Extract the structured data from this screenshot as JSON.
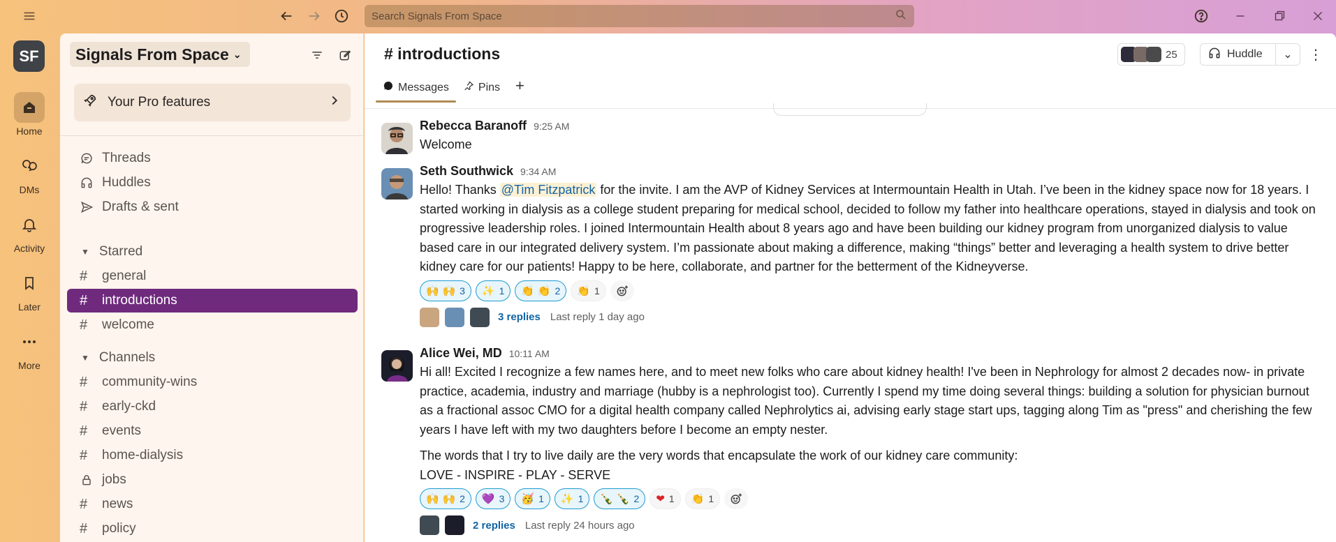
{
  "topbar": {
    "search_placeholder": "Search Signals From Space"
  },
  "rail": {
    "workspace_initials": "SF",
    "items": [
      {
        "label": "Home",
        "icon": "home-icon"
      },
      {
        "label": "DMs",
        "icon": "dms-icon"
      },
      {
        "label": "Activity",
        "icon": "bell-icon"
      },
      {
        "label": "Later",
        "icon": "bookmark-icon"
      },
      {
        "label": "More",
        "icon": "more-icon"
      }
    ]
  },
  "sidebar": {
    "workspace_name": "Signals From Space",
    "pro_features": "Your Pro features",
    "nav": [
      {
        "label": "Threads",
        "icon": "threads-icon"
      },
      {
        "label": "Huddles",
        "icon": "headphones-icon"
      },
      {
        "label": "Drafts & sent",
        "icon": "send-icon"
      }
    ],
    "starred_label": "Starred",
    "starred": [
      "general",
      "introductions",
      "welcome"
    ],
    "channels_label": "Channels",
    "channels": [
      {
        "name": "community-wins",
        "icon": "#"
      },
      {
        "name": "early-ckd",
        "icon": "#"
      },
      {
        "name": "events",
        "icon": "#"
      },
      {
        "name": "home-dialysis",
        "icon": "#"
      },
      {
        "name": "jobs",
        "icon": "lock"
      },
      {
        "name": "news",
        "icon": "#"
      },
      {
        "name": "policy",
        "icon": "#"
      }
    ]
  },
  "channel": {
    "title": "# introductions",
    "member_count": "25",
    "huddle_label": "Huddle",
    "tabs": [
      {
        "label": "Messages"
      },
      {
        "label": "Pins"
      }
    ]
  },
  "messages": [
    {
      "author": "Rebecca Baranoff",
      "time": "9:25 AM",
      "paragraphs": [
        "Welcome"
      ]
    },
    {
      "author": "Seth Southwick",
      "time": "9:34 AM",
      "text_before": "Hello! Thanks ",
      "mention": "@Tim Fitzpatrick",
      "text_after": " for the invite.  I am the AVP of Kidney Services at Intermountain Health in Utah.  I’ve been in the kidney space now for 18 years.  I started working in dialysis as a college student preparing for medical school, decided to follow my father into healthcare operations, stayed in dialysis and took on progressive leadership roles.  I joined Intermountain Health about 8 years ago and have been building our kidney program from unorganized dialysis to value based care in our integrated delivery system.  I’m passionate about making a difference, making “things” better and leveraging a health system to drive better kidney care for our patients!  Happy to be here, collaborate, and partner for the betterment of the Kidneyverse.",
      "reactions": [
        {
          "emoji": "🙌 🙌",
          "count": "3",
          "highlight": true
        },
        {
          "emoji": "✨",
          "count": "1",
          "highlight": true
        },
        {
          "emoji": "👏 👏",
          "count": "2",
          "highlight": true
        },
        {
          "emoji": "👏",
          "count": "1",
          "highlight": false
        }
      ],
      "thread": {
        "replies": "3 replies",
        "last": "Last reply 1 day ago"
      }
    },
    {
      "author": "Alice Wei, MD",
      "time": "10:11 AM",
      "paragraphs": [
        "Hi all! Excited I recognize a few names here, and to meet new folks who care about kidney health!  I've been in Nephrology for almost 2 decades now- in private practice, academia, industry and marriage (hubby is a nephrologist too). Currently I spend my time doing several things: building a solution for physician burnout as a fractional assoc CMO for a digital health company called Nephrolytics ai, advising early stage start ups, tagging along Tim as \"press\" and cherishing the few years I have left with my two daughters before I become an empty nester.",
        "The words that I try to live daily are the very words that encapsulate the work of our kidney care community:",
        "LOVE - INSPIRE - PLAY - SERVE"
      ],
      "reactions": [
        {
          "emoji": "🙌 🙌",
          "count": "2",
          "highlight": true
        },
        {
          "emoji": "💜",
          "count": "3",
          "highlight": true
        },
        {
          "emoji": "🥳",
          "count": "1",
          "highlight": true
        },
        {
          "emoji": "✨",
          "count": "1",
          "highlight": true
        },
        {
          "emoji": "🍾 🍾",
          "count": "2",
          "highlight": true
        },
        {
          "emoji": "❤",
          "count": "1",
          "highlight": false
        },
        {
          "emoji": "👏",
          "count": "1",
          "highlight": false
        }
      ],
      "thread": {
        "replies": "2 replies",
        "last": "Last reply 24 hours ago"
      }
    }
  ],
  "colors": {
    "active_channel": "#6f2a7d",
    "link": "#1264a3",
    "reaction_border": "#1d9bd1"
  }
}
